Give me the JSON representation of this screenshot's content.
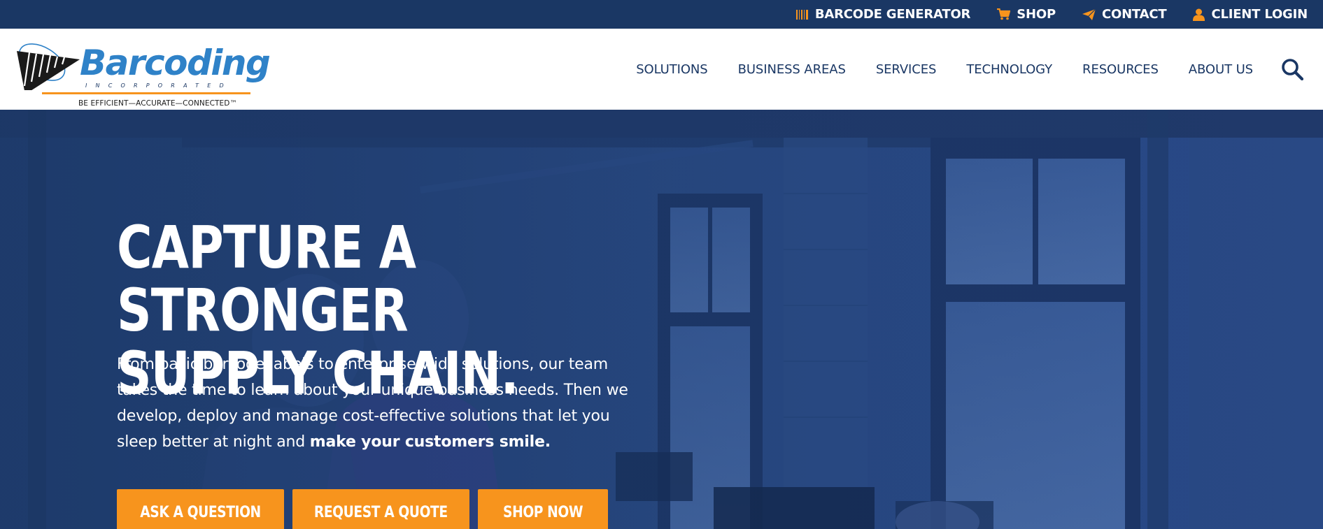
{
  "utility_nav": [
    {
      "icon": "barcode-icon",
      "label": "BARCODE GENERATOR"
    },
    {
      "icon": "cart-icon",
      "label": "SHOP"
    },
    {
      "icon": "paper-plane-icon",
      "label": "CONTACT"
    },
    {
      "icon": "user-icon",
      "label": "CLIENT LOGIN"
    }
  ],
  "logo": {
    "wordmark": "Barcoding",
    "sub": "INCORPORATED",
    "tagline": "BE EFFICIENT—ACCURATE—CONNECTED™"
  },
  "main_nav": [
    "SOLUTIONS",
    "BUSINESS AREAS",
    "SERVICES",
    "TECHNOLOGY",
    "RESOURCES",
    "ABOUT US"
  ],
  "search": {
    "icon": "search-icon"
  },
  "hero": {
    "title_line1": "CAPTURE A STRONGER",
    "title_line2": "SUPPLY CHAIN.",
    "body": "From basic barcode labels to enterprise-wide solutions, our team takes the time to learn about your unique business needs. Then we develop, deploy and manage cost-effective solutions that let you sleep better at night and ",
    "body_bold": "make your customers smile.",
    "buttons": {
      "ask": "ASK A QUESTION",
      "quote": "REQUEST A QUOTE",
      "shop": "SHOP NOW"
    }
  },
  "colors": {
    "utility_bar": "#1a3764",
    "brand_blue": "#2f82c8",
    "navy": "#1a3764",
    "accent_orange": "#f7941d"
  }
}
